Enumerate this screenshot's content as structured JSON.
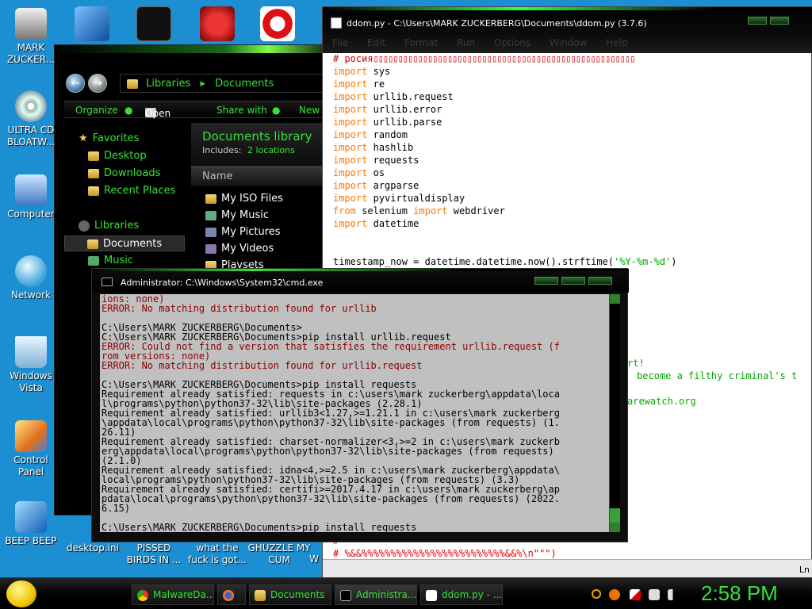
{
  "desktop": {
    "icons": [
      {
        "label": "MARK ZUCKER..."
      },
      {
        "label": "ULTRA CD BLOATW..."
      },
      {
        "label": "Computer"
      },
      {
        "label": "Network"
      },
      {
        "label": "Windows Vista"
      },
      {
        "label": "Control Panel"
      },
      {
        "label": "BEEP BEEP"
      }
    ],
    "bottom_labels": [
      "desktop.ini",
      "PISSED BIRDS IN ...",
      "what the fuck is got...",
      "GHUZZLE MY CUM",
      "W"
    ]
  },
  "explorer": {
    "breadcrumb": [
      "Libraries",
      "Documents"
    ],
    "toolbar": {
      "organize": "Organize",
      "open": "Open",
      "share": "Share with",
      "new_folder": "New fo"
    },
    "nav": {
      "favorites": "Favorites",
      "desktop": "Desktop",
      "downloads": "Downloads",
      "recent": "Recent Places",
      "libraries": "Libraries",
      "documents": "Documents",
      "music": "Music"
    },
    "library_title": "Documents library",
    "includes_label": "Includes:",
    "includes_link": "2 locations",
    "column_name": "Name",
    "files": [
      "My ISO Files",
      "My Music",
      "My Pictures",
      "My Videos",
      "Playsets"
    ]
  },
  "idle": {
    "title": "ddom.py - C:\\Users\\MARK ZUCKERBERG\\Documents\\ddom.py (3.7.6)",
    "menus": [
      "File",
      "Edit",
      "Format",
      "Run",
      "Options",
      "Window",
      "Help"
    ],
    "comment_first": "# росия",
    "imports": [
      "sys",
      "re",
      "urllib.request",
      "urllib.error",
      "urllib.parse",
      "random",
      "hashlib",
      "requests",
      "os",
      "argparse",
      "pyvirtualdisplay"
    ],
    "from_line": {
      "from": "from",
      "module": "selenium",
      "import": "import",
      "name": "webdriver"
    },
    "last_import": "datetime",
    "keyword_import": "import",
    "timestamp_line_prefix": "timestamp_now = datetime.datetime.now().strftime(",
    "timestamp_fmt": "'%Y-%m-%d'",
    "timestamp_line_suffix": ")",
    "fragment_1": "rt!",
    "fragment_2": "become a filthy criminal's t",
    "fragment_3": "arewatch.org",
    "comment_tail_1": "#",
    "comment_tail_2": "# %&&%%%%%%%%%%%%%%%%%%%%%%%%%&&%\\n\"\"\")",
    "status": "Ln"
  },
  "cmd": {
    "title": "Administrator: C:\\Windows\\System32\\cmd.exe",
    "lines": [
      {
        "text": "ions: none)",
        "err": true
      },
      {
        "text": "ERROR: No matching distribution found for urllib",
        "err": true
      },
      {
        "text": "",
        "err": false
      },
      {
        "text": "C:\\Users\\MARK ZUCKERBERG\\Documents>",
        "err": false
      },
      {
        "text": "C:\\Users\\MARK ZUCKERBERG\\Documents>pip install urllib.request",
        "err": false
      },
      {
        "text": "ERROR: Could not find a version that satisfies the requirement urllib.request (f",
        "err": true
      },
      {
        "text": "rom versions: none)",
        "err": true
      },
      {
        "text": "ERROR: No matching distribution found for urllib.request",
        "err": true
      },
      {
        "text": "",
        "err": false
      },
      {
        "text": "C:\\Users\\MARK ZUCKERBERG\\Documents>pip install requests",
        "err": false
      },
      {
        "text": "Requirement already satisfied: requests in c:\\users\\mark zuckerberg\\appdata\\loca",
        "err": false
      },
      {
        "text": "l\\programs\\python\\python37-32\\lib\\site-packages (2.28.1)",
        "err": false
      },
      {
        "text": "Requirement already satisfied: urllib3<1.27,>=1.21.1 in c:\\users\\mark zuckerberg",
        "err": false
      },
      {
        "text": "\\appdata\\local\\programs\\python\\python37-32\\lib\\site-packages (from requests) (1.",
        "err": false
      },
      {
        "text": "26.11)",
        "err": false
      },
      {
        "text": "Requirement already satisfied: charset-normalizer<3,>=2 in c:\\users\\mark zuckerb",
        "err": false
      },
      {
        "text": "erg\\appdata\\local\\programs\\python\\python37-32\\lib\\site-packages (from requests)",
        "err": false
      },
      {
        "text": "(2.1.0)",
        "err": false
      },
      {
        "text": "Requirement already satisfied: idna<4,>=2.5 in c:\\users\\mark zuckerberg\\appdata\\",
        "err": false
      },
      {
        "text": "local\\programs\\python\\python37-32\\lib\\site-packages (from requests) (3.3)",
        "err": false
      },
      {
        "text": "Requirement already satisfied: certifi>=2017.4.17 in c:\\users\\mark zuckerberg\\ap",
        "err": false
      },
      {
        "text": "pdata\\local\\programs\\python\\python37-32\\lib\\site-packages (from requests) (2022.",
        "err": false
      },
      {
        "text": "6.15)",
        "err": false
      },
      {
        "text": "",
        "err": false
      },
      {
        "text": "C:\\Users\\MARK ZUCKERBERG\\Documents>pip install requests",
        "err": false
      }
    ]
  },
  "taskbar": {
    "buttons": [
      "MalwareDa...",
      "",
      "Documents",
      "Administra...",
      "ddom.py - ..."
    ],
    "clock": "2:58 PM"
  },
  "colors": {
    "accent_green": "#35e335",
    "desktop_blue": "#1c8fd3",
    "console_bg": "#c0c0c0",
    "error_red": "#8b0000"
  }
}
